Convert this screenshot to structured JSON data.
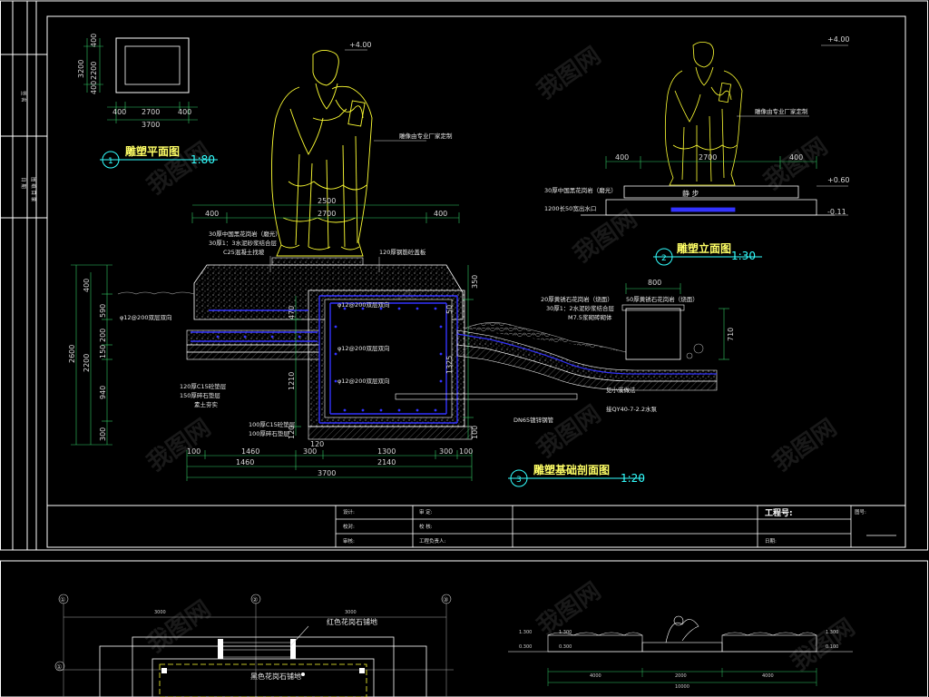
{
  "drawing": {
    "plan": {
      "title": "雕塑平面图",
      "scale": "1:80",
      "callout": "1",
      "dims_h": [
        "400",
        "2700",
        "400",
        "3700"
      ],
      "dims_v": [
        "400",
        "2200",
        "400",
        "3200"
      ]
    },
    "elevation_left": {
      "elev_top": "+4.00",
      "note": "雕像由专业厂家定制",
      "dims_top": [
        "400",
        "2500",
        "2700",
        "400"
      ]
    },
    "elevation_right": {
      "title": "雕塑立面图",
      "scale": "1:30",
      "callout": "2",
      "elev_top": "+4.00",
      "elev_mid": "+0.60",
      "elev_low": "-0.11",
      "note": "雕像由专业厂家定制",
      "dims_top": [
        "400",
        "2700",
        "400"
      ],
      "base_note_1": "30厚中国黑花岗岩（磨光）",
      "base_note_2": "1200长50宽出水口",
      "plinth_text": "静 步"
    },
    "section": {
      "title": "雕塑基础剖面图",
      "scale": "1:20",
      "callout": "3",
      "notes_left": [
        "30厚中国黑花岗岩（磨光）",
        "30厚1：3水泥砂浆结合层",
        "C25混凝土找坡"
      ],
      "note_slab": "120厚钢筋砼盖板",
      "rebar_1": "φ12@200双层双向",
      "rebar_2": "φ12@200双层双向",
      "rebar_3": "φ12@200双层双向",
      "rebar_4": "φ12@200双层双向",
      "notes_bottom_left": [
        "120厚C15砼垫层",
        "150厚碎石垫层",
        "素土夯实"
      ],
      "notes_bottom_mid": [
        "100厚C15砼垫层",
        "100厚碎石垫层"
      ],
      "notes_right": [
        "20厚黄锈石花岗岩（烧面）",
        "30厚1：2水泥砂浆结合层",
        "M7.5浆砌砖砌体"
      ],
      "note_box": "50厚黄锈石花岗岩（烧面）",
      "note_drain": "见小溪做法",
      "note_pipe": "DN65镀锌钢管",
      "note_pump": "接QY40-7-2.2水泵",
      "dims_v_left": [
        "400",
        "590",
        "200",
        "150",
        "940",
        "300",
        "2200",
        "2600"
      ],
      "dims_v_mid": [
        "470",
        "1210",
        "120"
      ],
      "dims_v_mid2": [
        "50",
        "1325",
        "100",
        "350"
      ],
      "dims_v_right": [
        "800",
        "710"
      ],
      "dims_bottom_1": [
        "100",
        "1460",
        "300",
        "1300",
        "300",
        "100"
      ],
      "dims_bottom_2": [
        "1460",
        "2140"
      ],
      "dims_bottom_3": [
        "3700"
      ],
      "dim_120": "120"
    },
    "title_block": {
      "row1": [
        "设计:",
        "审 定:"
      ],
      "row2": [
        "校对:",
        "校 核:"
      ],
      "row3": [
        "审核:",
        "工程负责人:"
      ],
      "project_label": "工程号:",
      "date_label": "日期:",
      "sheet_label": "图号:"
    },
    "side_strip": [
      "签 名",
      "日 期",
      "图 纸 目 录"
    ]
  },
  "lower_sheet": {
    "plan_note_1": "红色花岗石铺地",
    "plan_note_2": "黑色花岗石铺地",
    "grid_marks": [
      "①",
      "②",
      "③"
    ],
    "grid_dims": [
      "3000",
      "3000"
    ],
    "grid_row": "①",
    "elev_labels": [
      "1.300",
      "0.300",
      "0.300",
      "1.300"
    ],
    "elev_dims": [
      "4000",
      "2000",
      "4000"
    ],
    "elev_total": "10000",
    "elev_right": [
      "0.100",
      "1.300"
    ]
  },
  "colors": {
    "background": "#000000",
    "frame": "#ffffff",
    "statue": "#ffff33",
    "dimension": "#33cc66",
    "rebar": "#3333ff",
    "callout": "#33ffff",
    "watermark": "#333333"
  },
  "watermark": "我图网"
}
